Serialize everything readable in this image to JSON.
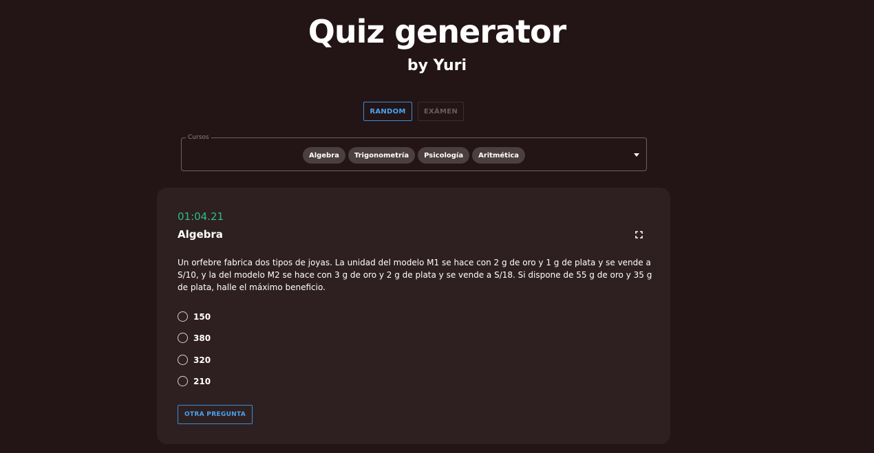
{
  "header": {
    "title": "Quiz generator",
    "subtitle": "by Yuri"
  },
  "modes": {
    "random_label": "RANDOM",
    "exam_label": "EXÁMEN"
  },
  "courses": {
    "legend": "Cursos",
    "chips": [
      "Algebra",
      "Trigonometría",
      "Psicología",
      "Aritmética"
    ]
  },
  "quiz": {
    "timer": "01:04.21",
    "course": "Algebra",
    "question": "Un orfebre fabrica dos tipos de joyas. La unidad del modelo M1 se hace con 2 g de oro y 1 g de plata y se vende a S/10, y la del modelo M2 se hace con 3 g de oro y 2 g de plata y se vende a S/18. Si dispone de 55 g de oro y 35 g de plata, halle el máximo beneficio.",
    "options": [
      "150",
      "380",
      "320",
      "210"
    ],
    "next_label": "OTRA PREGUNTA"
  },
  "icons": {
    "fullscreen": "fullscreen-icon",
    "dropdown": "chevron-down-icon"
  },
  "colors": {
    "background": "#231516",
    "card": "#2e2021",
    "accent": "#4aa3f0",
    "timer": "#2fbb8c"
  }
}
